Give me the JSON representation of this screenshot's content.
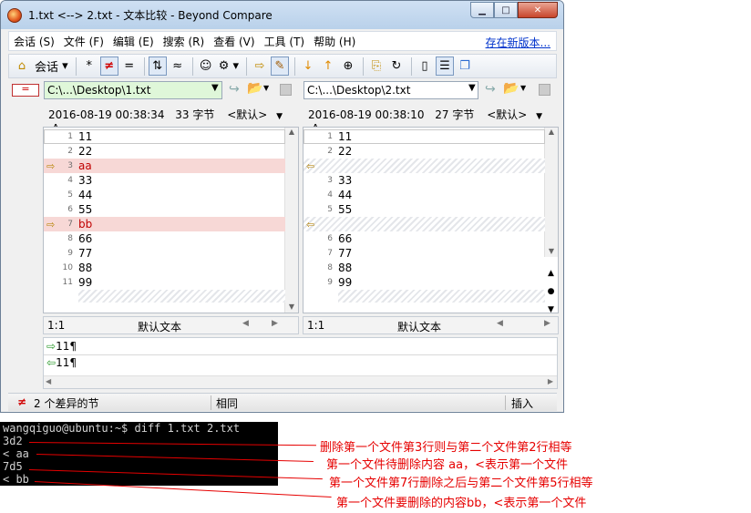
{
  "window": {
    "title": "1.txt <--> 2.txt - 文本比较 - Beyond Compare",
    "buttons": {
      "min": "▁",
      "max": "□",
      "close": "✕"
    }
  },
  "menu": {
    "items": [
      "会话 (S)",
      "文件 (F)",
      "编辑 (E)",
      "搜索 (R)",
      "查看 (V)",
      "工具 (T)",
      "帮助 (H)"
    ],
    "right_link": "存在新版本..."
  },
  "toolbar": {
    "session_label": "会话",
    "icons": [
      "home-icon",
      "all-icon",
      "diff-icon",
      "same-icon",
      "context-icon",
      "minor-icon",
      "rules-icon",
      "format-icon",
      "swap-icon",
      "edit-icon",
      "next-diff-icon",
      "prev-diff-icon",
      "find-icon",
      "copy-icon",
      "refresh-icon",
      "text-icon",
      "layout-icon",
      "options-icon"
    ]
  },
  "left": {
    "path": "C:\\...\\Desktop\\1.txt",
    "date": "2016-08-19 00:38:34",
    "size": "33 字节",
    "encoding": "<默认>",
    "font": "A",
    "lines": [
      {
        "n": "1",
        "t": "11",
        "type": "same"
      },
      {
        "n": "2",
        "t": "22",
        "type": "same"
      },
      {
        "n": "3",
        "t": "aa",
        "type": "del"
      },
      {
        "n": "4",
        "t": "33",
        "type": "same"
      },
      {
        "n": "5",
        "t": "44",
        "type": "same"
      },
      {
        "n": "6",
        "t": "55",
        "type": "same"
      },
      {
        "n": "7",
        "t": "bb",
        "type": "del"
      },
      {
        "n": "8",
        "t": "66",
        "type": "same"
      },
      {
        "n": "9",
        "t": "77",
        "type": "same"
      },
      {
        "n": "10",
        "t": "88",
        "type": "same"
      },
      {
        "n": "11",
        "t": "99",
        "type": "same"
      }
    ],
    "pos": "1:1",
    "format": "默认文本"
  },
  "right": {
    "path": "C:\\...\\Desktop\\2.txt",
    "date": "2016-08-19 00:38:10",
    "size": "27 字节",
    "encoding": "<默认>",
    "font": "A",
    "lines": [
      {
        "n": "1",
        "t": "11",
        "type": "same"
      },
      {
        "n": "2",
        "t": "22",
        "type": "same"
      },
      {
        "n": "",
        "t": "",
        "type": "gap"
      },
      {
        "n": "3",
        "t": "33",
        "type": "same"
      },
      {
        "n": "4",
        "t": "44",
        "type": "same"
      },
      {
        "n": "5",
        "t": "55",
        "type": "same"
      },
      {
        "n": "",
        "t": "",
        "type": "gap"
      },
      {
        "n": "6",
        "t": "66",
        "type": "same"
      },
      {
        "n": "7",
        "t": "77",
        "type": "same"
      },
      {
        "n": "8",
        "t": "88",
        "type": "same"
      },
      {
        "n": "9",
        "t": "99",
        "type": "same"
      }
    ],
    "pos": "1:1",
    "format": "默认文本"
  },
  "bottom": {
    "line1": "11¶",
    "line2": "11¶"
  },
  "status": {
    "diffs": "2 个差异的节",
    "same": "相同",
    "mode": "插入"
  },
  "terminal": {
    "lines": [
      "wangqiguo@ubuntu:~$ diff 1.txt 2.txt",
      "3d2",
      "< aa",
      "7d5",
      "< bb"
    ]
  },
  "annotations": [
    "删除第一个文件第3行则与第二个文件第2行相等",
    "第一个文件待删除内容 aa，<表示第一个文件",
    "第一个文件第7行删除之后与第二个文件第5行相等",
    "第一个文件要删除的内容bb，<表示第一个文件"
  ]
}
